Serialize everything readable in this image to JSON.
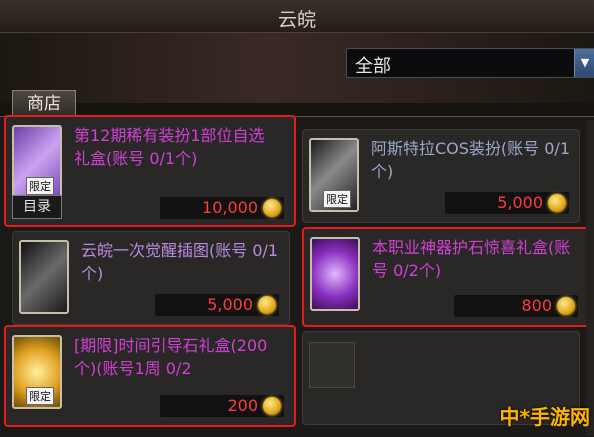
{
  "window": {
    "title": "云皖"
  },
  "filter": {
    "value": "全部"
  },
  "tabs": {
    "shop": "商店"
  },
  "items": [
    {
      "name": "第12期稀有装扮1部位自选礼盒(账号 0/1个)",
      "price": "10,000",
      "badge": "限定",
      "catalog": "目录",
      "color": "#d040d4"
    },
    {
      "name": "阿斯特拉COS装扮(账号 0/1个)",
      "price": "5,000",
      "badge": "限定",
      "color": "#9aa6cc"
    },
    {
      "name": "云皖一次觉醒插图(账号 0/1个)",
      "price": "5,000",
      "color": "#b88ae0"
    },
    {
      "name": "本职业神器护石惊喜礼盒(账号 0/2个)",
      "price": "800",
      "color": "#d040d4"
    },
    {
      "name": "[期限]时间引导石礼盒(200个)(账号1周 0/2",
      "price": "200",
      "badge": "限定",
      "color": "#d040d4"
    }
  ],
  "watermark": "中*手游网",
  "icons": [
    "purple-gift-icon",
    "astra-costume-icon",
    "awakening-illustration-icon",
    "artifact-stone-gift-icon",
    "time-stone-box-icon",
    "gold-coin-icon",
    "dropdown-arrow-icon"
  ]
}
